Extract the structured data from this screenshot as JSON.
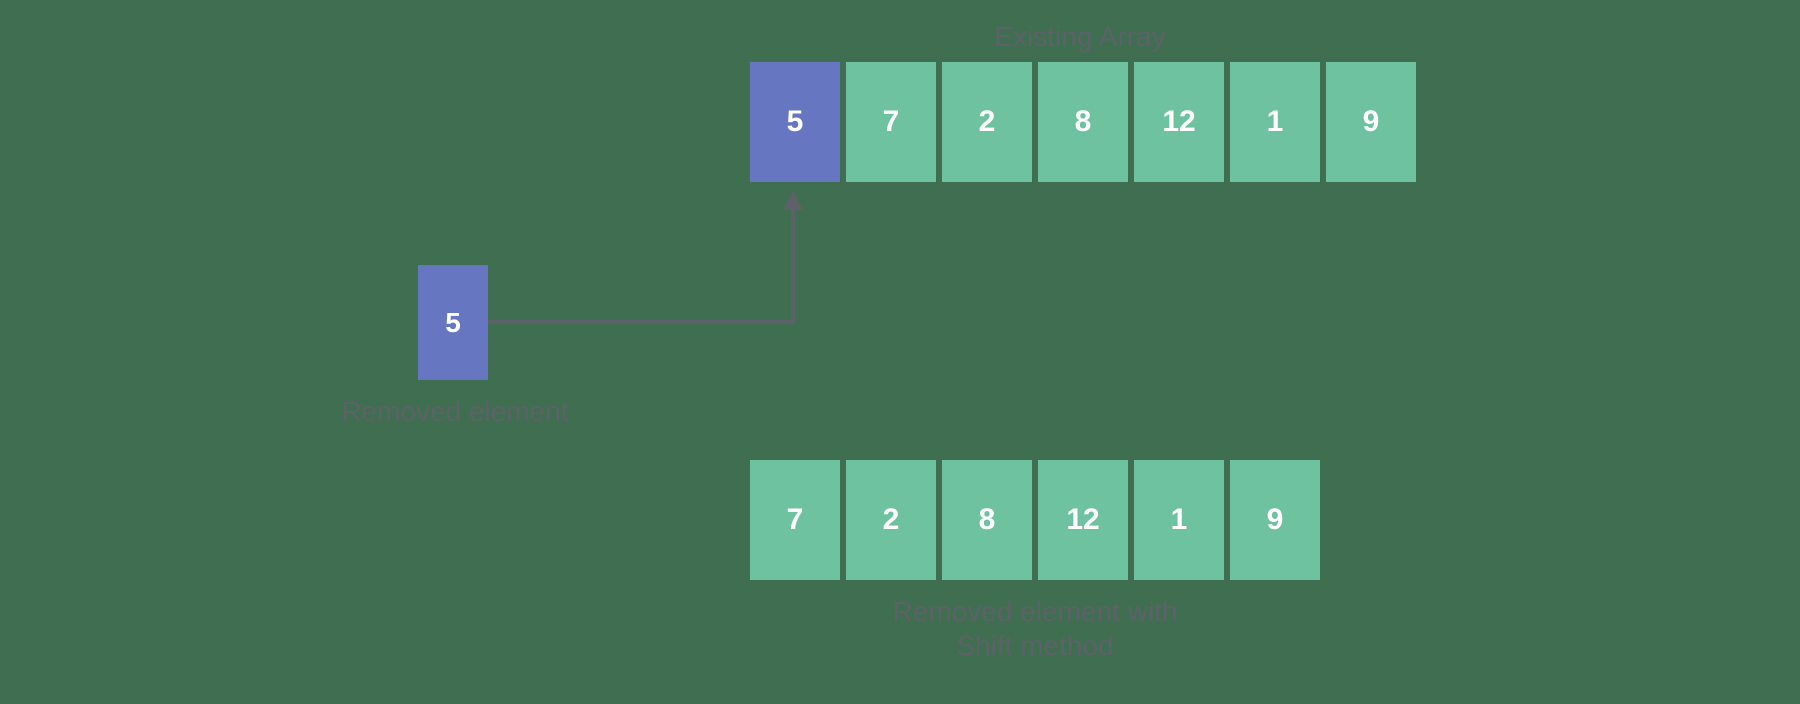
{
  "labels": {
    "existing": "Existing Array",
    "removed": "Removed element",
    "result_l1": "Removed element with",
    "result_l2": "Shift method"
  },
  "existingArray": [
    "5",
    "7",
    "2",
    "8",
    "12",
    "1",
    "9"
  ],
  "removedValue": "5",
  "resultArray": [
    "7",
    "2",
    "8",
    "12",
    "1",
    "9"
  ],
  "colors": {
    "teal": "#6ec2a0",
    "blue": "#6676c0",
    "label": "#5d6168",
    "bg": "#3f6f50"
  }
}
